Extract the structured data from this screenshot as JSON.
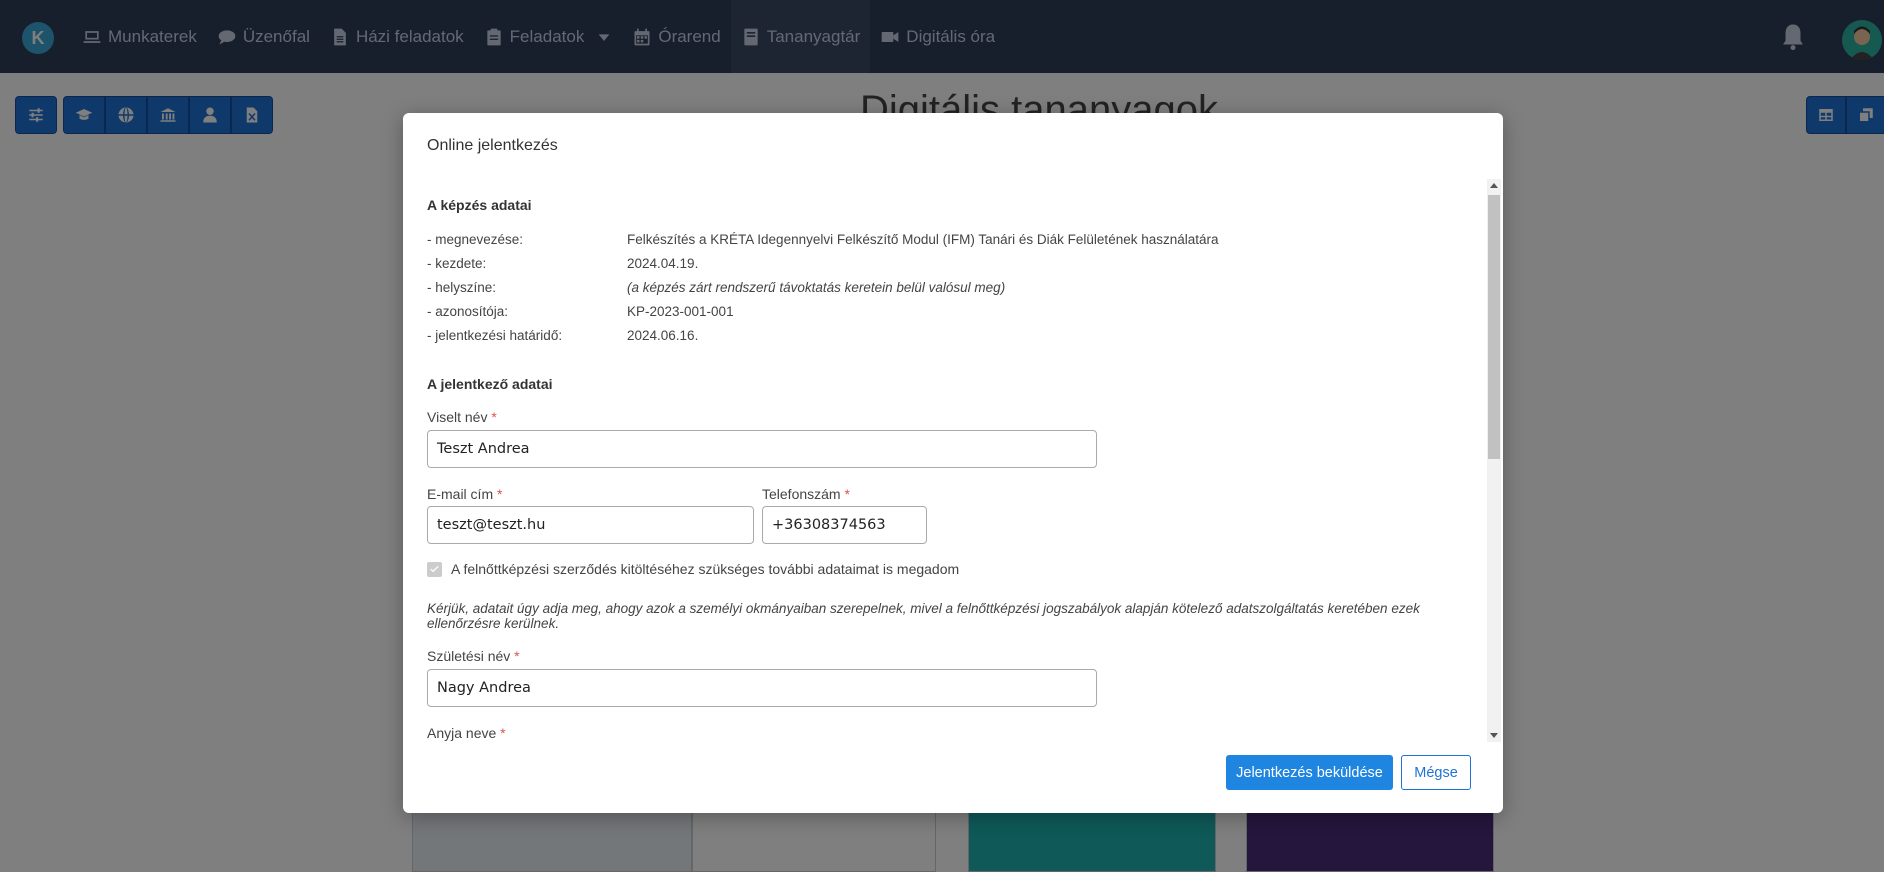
{
  "nav": {
    "logo_letter": "K",
    "items": [
      {
        "label": "Munkaterek",
        "icon": "laptop-icon"
      },
      {
        "label": "Üzenőfal",
        "icon": "comment-icon"
      },
      {
        "label": "Házi feladatok",
        "icon": "file-icon"
      },
      {
        "label": "Feladatok",
        "icon": "clipboard-icon"
      },
      {
        "label": "Órarend",
        "icon": "calendar-icon"
      },
      {
        "label": "Tananyagtár",
        "icon": "book-icon"
      },
      {
        "label": "Digitális óra",
        "icon": "video-icon"
      }
    ],
    "active_item": "Tananyagtár"
  },
  "page": {
    "title": "Digitális tananyagok"
  },
  "modal": {
    "title": "Online jelentkezés",
    "training_section_title": "A képzés adatai",
    "training": [
      {
        "label": "- megnevezése:",
        "value": "Felkészítés a KRÉTA Idegennyelvi Felkészítő Modul (IFM) Tanári és Diák Felületének használatára"
      },
      {
        "label": "- kezdete:",
        "value": "2024.04.19."
      },
      {
        "label": "- helyszíne:",
        "value": "(a képzés zárt rendszerű távoktatás keretein belül valósul meg)"
      },
      {
        "label": "- azonosítója:",
        "value": "KP-2023-001-001"
      },
      {
        "label": "- jelentkezési határidő:",
        "value": "2024.06.16."
      }
    ],
    "applicant_section_title": "A jelentkező adatai",
    "fields": {
      "name_label": "Viselt név",
      "name_value": "Teszt Andrea",
      "email_label": "E-mail cím",
      "email_value": "teszt@teszt.hu",
      "phone_label": "Telefonszám",
      "phone_value": "+36308374563",
      "birth_name_label": "Születési név",
      "birth_name_value": "Nagy Andrea",
      "mother_name_label": "Anyja neve",
      "required_mark": "*"
    },
    "checkbox_label": "A felnőttképzési szerződés kitöltéséhez szükséges további adataimat is megadom",
    "checkbox_checked": true,
    "note": "Kérjük, adatait úgy adja meg, ahogy azok a személyi okmányaiban szerepelnek, mivel a felnőttképzési jogszabályok alapján kötelező adatszolgáltatás keretében ezek ellenőrzésre kerülnek.",
    "submit_label": "Jelentkezés beküldése",
    "cancel_label": "Mégse"
  },
  "colors": {
    "navbar": "#2f3e5b",
    "primary": "#1e85e0",
    "required": "#d9534f"
  }
}
